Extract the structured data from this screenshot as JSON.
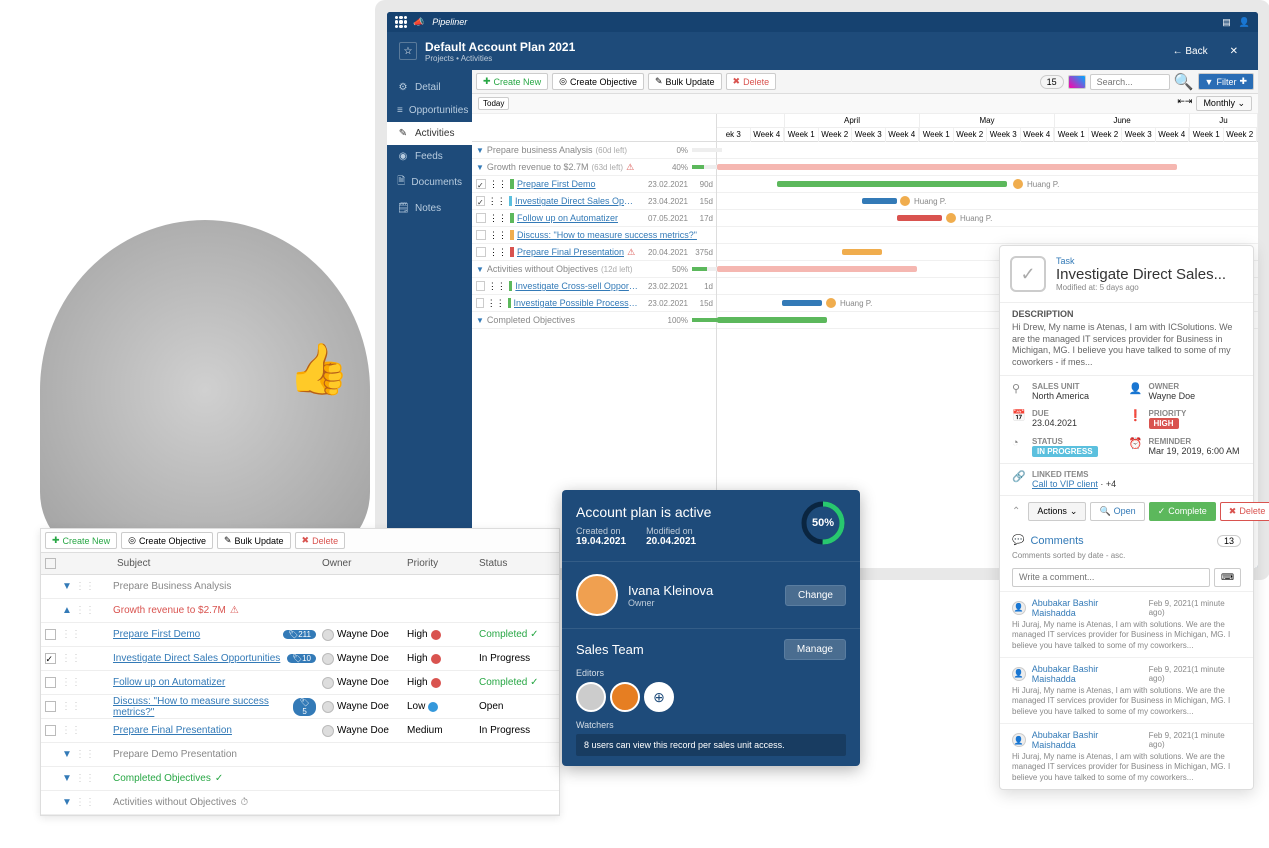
{
  "topnav": {
    "brand": "Pipeliner"
  },
  "header": {
    "title": "Default Account Plan 2021",
    "crumbs": "Projects  •  Activities",
    "back": "Back"
  },
  "sidebar": {
    "items": [
      {
        "label": "Detail"
      },
      {
        "label": "Opportunities"
      },
      {
        "label": "Activities"
      },
      {
        "label": "Feeds"
      },
      {
        "label": "Documents"
      },
      {
        "label": "Notes"
      }
    ]
  },
  "toolbar": {
    "create_new": "Create New",
    "create_objective": "Create Objective",
    "bulk_update": "Bulk Update",
    "delete": "Delete",
    "count": "15",
    "search_ph": "Search...",
    "filter": "Filter"
  },
  "subtoolbar": {
    "today": "Today",
    "monthly": "Monthly"
  },
  "months": [
    "April",
    "May",
    "June",
    "Ju"
  ],
  "weeks_prefix": [
    "ek 3",
    "Week 4"
  ],
  "weeks": [
    "Week 1",
    "Week 2",
    "Week 3",
    "Week 4"
  ],
  "weeks_last": [
    "Week 1",
    "Week 2"
  ],
  "gantt_rows": [
    {
      "type": "group",
      "name": "Prepare business Analysis",
      "meta": "(60d left)",
      "pct": "0%"
    },
    {
      "type": "group",
      "cls": "growth",
      "name": "Growth revenue to $2.7M",
      "meta": "(63d left)",
      "warn": true,
      "pct": "40%"
    },
    {
      "type": "task",
      "chk": true,
      "mrk": "mrk-green",
      "name": "Prepare First Demo",
      "date": "23.02.2021",
      "days": "90d"
    },
    {
      "type": "task",
      "chk": true,
      "mrk": "mrk-blue",
      "name": "Investigate Direct Sales Opportunities",
      "date": "23.04.2021",
      "days": "15d"
    },
    {
      "type": "task",
      "mrk": "mrk-green",
      "name": "Follow up on Automatizer",
      "date": "07.05.2021",
      "days": "17d"
    },
    {
      "type": "task",
      "mrk": "mrk-yellow",
      "name": "Discuss: \"How to measure success metrics?\"",
      "date": "",
      "days": ""
    },
    {
      "type": "task",
      "mrk": "mrk-red",
      "name": "Prepare Final Presentation",
      "warn": true,
      "date": "20.04.2021",
      "days": "375d"
    },
    {
      "type": "group",
      "name": "Activities without Objectives",
      "meta": "(12d left)",
      "pct": "50%"
    },
    {
      "type": "task",
      "mrk": "mrk-green",
      "name": "Investigate Cross-sell Opportunities",
      "date": "23.02.2021",
      "days": "1d"
    },
    {
      "type": "task",
      "mrk": "mrk-green",
      "name": "Investigate Possible Process Improvements",
      "date": "23.02.2021",
      "days": "15d"
    },
    {
      "type": "group",
      "cls": "completed",
      "name": "Completed Objectives",
      "pct": "100%"
    }
  ],
  "gantt_people": [
    "Huang P.",
    "Huang P.",
    "Huang P.",
    "Huang P."
  ],
  "task_panel": {
    "type": "Task",
    "title": "Investigate Direct Sales...",
    "modified": "Modified at: 5 days ago",
    "desc_label": "DESCRIPTION",
    "desc": "Hi Drew, My name is Atenas, I am with ICSolutions. We are the managed IT services provider for Business in Michigan, MG. I believe you have talked to some of my coworkers - if mes...",
    "sales_unit_l": "SALES UNIT",
    "sales_unit_v": "North America",
    "owner_l": "OWNER",
    "owner_v": "Wayne Doe",
    "due_l": "DUE",
    "due_v": "23.04.2021",
    "priority_l": "PRIORITY",
    "priority_v": "HIGH",
    "status_l": "STATUS",
    "status_v": "IN PROGRESS",
    "reminder_l": "REMINDER",
    "reminder_v": "Mar 19, 2019, 6:00 AM",
    "linked_l": "LINKED ITEMS",
    "linked_v": "Call to VIP client",
    "linked_more": "+4",
    "actions": "Actions",
    "open": "Open",
    "complete": "Complete",
    "del": "Delete",
    "comments_title": "Comments",
    "comments_count": "13",
    "comments_sort": "Comments sorted by date - asc.",
    "comment_ph": "Write a comment...",
    "comments": [
      {
        "name": "Abubakar Bashir Maishadda",
        "date": "Feb 9, 2021(1 minute ago)",
        "text": "Hi Juraj, My name is Atenas, I am with solutions. We are the managed IT services provider for Business in Michigan, MG. I believe you have talked to some of my coworkers..."
      },
      {
        "name": "Abubakar Bashir Maishadda",
        "date": "Feb 9, 2021(1 minute ago)",
        "text": "Hi Juraj, My name is Atenas, I am with solutions. We are the managed IT services provider for Business in Michigan, MG. I believe you have talked to some of my coworkers..."
      },
      {
        "name": "Abubakar Bashir Maishadda",
        "date": "Feb 9, 2021(1 minute ago)",
        "text": "Hi Juraj, My name is Atenas, I am with solutions. We are the managed IT services provider for Business in Michigan, MG. I believe you have talked to some of my coworkers..."
      }
    ]
  },
  "account_card": {
    "title": "Account plan is active",
    "created_l": "Created on",
    "created_v": "19.04.2021",
    "modified_l": "Modified on",
    "modified_v": "20.04.2021",
    "pct": "50%",
    "owner_name": "Ivana Kleinova",
    "owner_role": "Owner",
    "change": "Change",
    "team_title": "Sales Team",
    "manage": "Manage",
    "editors_l": "Editors",
    "watchers_l": "Watchers",
    "watchers_text": "8 users can view this record per sales unit access."
  },
  "bottom_table": {
    "head": {
      "subject": "Subject",
      "owner": "Owner",
      "priority": "Priority",
      "status": "Status"
    },
    "rows": [
      {
        "type": "group",
        "caret": "▼",
        "name": "Prepare Business Analysis"
      },
      {
        "type": "group",
        "cls": "growth",
        "caret": "▲",
        "name": "Growth revenue to $2.7M",
        "warn": true
      },
      {
        "type": "task",
        "mrk": "mrk-green",
        "tag": "211",
        "name": "Prepare First Demo",
        "owner": "Wayne Doe",
        "priority": "High",
        "pri": "high",
        "status": "Completed",
        "done": true
      },
      {
        "type": "task",
        "chk": true,
        "mrk": "mrk-blue",
        "tag": "10",
        "name": "Investigate Direct Sales Opportunities",
        "owner": "Wayne Doe",
        "priority": "High",
        "pri": "high",
        "status": "In Progress"
      },
      {
        "type": "task",
        "mrk": "mrk-green",
        "name": "Follow up on Automatizer",
        "owner": "Wayne Doe",
        "priority": "High",
        "pri": "high",
        "status": "Completed",
        "done": true
      },
      {
        "type": "task",
        "mrk": "mrk-yellow",
        "tag": "5",
        "name": "Discuss: \"How to measure success metrics?\"",
        "owner": "Wayne Doe",
        "priority": "Low",
        "pri": "low",
        "status": "Open"
      },
      {
        "type": "task",
        "mrk": "mrk-red",
        "name": "Prepare Final Presentation",
        "owner": "Wayne Doe",
        "priority": "Medium",
        "status": "In Progress"
      },
      {
        "type": "group",
        "caret": "▼",
        "name": "Prepare Demo Presentation"
      },
      {
        "type": "group",
        "cls": "done",
        "caret": "▼",
        "name": "Completed Objectives",
        "tick": true
      },
      {
        "type": "group",
        "caret": "▼",
        "name": "Activities without Objectives",
        "clock": true
      }
    ]
  }
}
